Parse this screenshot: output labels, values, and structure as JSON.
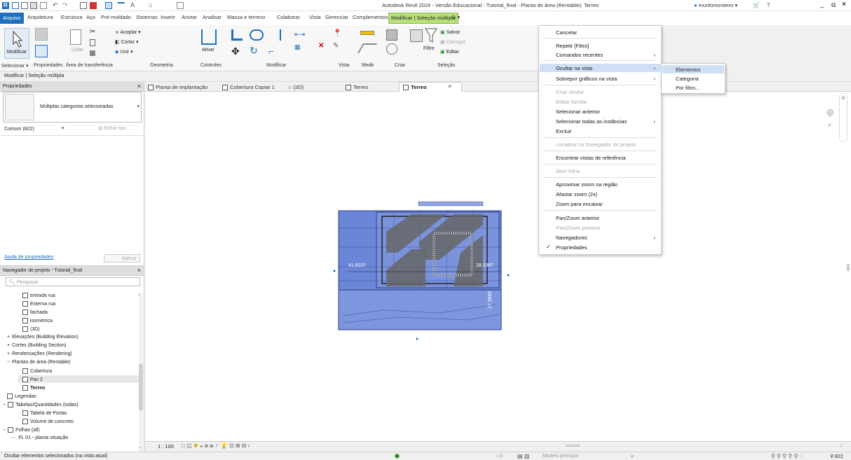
{
  "app": {
    "title": "Autodesk Revit 2024 - Versão Educacional - Tutorial_final - Planta de área (Rentable): Terreo",
    "user": "murilomonteiro"
  },
  "menubar": {
    "tabs": [
      "Arquivo",
      "Arquitetura",
      "Estrutura",
      "Aço",
      "Pré-moldado",
      "Sistemas",
      "Inserir",
      "Anotar",
      "Analisar",
      "Massa e terreno",
      "Colaborar",
      "Vista",
      "Gerenciar",
      "Complementos",
      "Modificar | Seleção múltipla"
    ]
  },
  "ribbon": {
    "modificar": "Modificar",
    "colar": "Colar",
    "acoplar": "Acoplar",
    "cortar": "Cortar",
    "unir": "Unir",
    "ativar": "Ativar",
    "salvar": "Salvar",
    "carregar": "Carregar",
    "editar": "Editar",
    "filtro": "Filtro",
    "panels": [
      "Selecionar ▾",
      "Propriedades",
      "Área de transferência",
      "Geometria",
      "Controles",
      "Modificar",
      "Vista",
      "Medir",
      "Criar",
      "Seleção"
    ]
  },
  "context_bar": "Modificar | Seleção múltipla",
  "properties": {
    "title": "Propriedades",
    "type_label": "Múltiplas categorias selecionadas",
    "filter": "Comum (822)",
    "edit_type": "Editar tipo",
    "help_link": "Ajuda de propriedades",
    "apply": "Aplicar"
  },
  "browser": {
    "title": "Navegador de projeto - Tutorial_final",
    "search_placeholder": "Pesquisar",
    "items": [
      "entrada rua",
      "Externa rua",
      "fachada",
      "isometrica",
      "(3D)",
      "Elevações (Building Elevation)",
      "Cortes (Building Section)",
      "Renderizações (Rendering)",
      "Plantas de área (Rentable)",
      "Cobertura",
      "Pav 2",
      "Terreo",
      "Legendas",
      "Tabelas/Quantidades (todas)",
      "Tabela de Portas",
      "Volume de concreto",
      "Folhas (all)",
      "FL 01 - planta situação"
    ]
  },
  "doc_tabs": [
    "Planta de implantação",
    "Cobertura Copiar 1",
    "{3D}",
    "Terreo",
    "Terreo"
  ],
  "canvas": {
    "dim1": "41.6037",
    "dim2": "28.1967",
    "dim3": "17.3685"
  },
  "view_bar": {
    "scale": "1 : 100"
  },
  "context_menu": {
    "cancelar": "Cancelar",
    "repetir": "Repetir [Filtro]",
    "recentes": "Comandos recentes",
    "ocultar": "Ocultar na vista",
    "sobrepor": "Sobrepor gráficos na vista",
    "criar_similar": "Criar similar",
    "editar_familia": "Editar família",
    "sel_anterior": "Selecionar anterior",
    "sel_todas": "Selecionar todas as instâncias",
    "excluir": "Excluir",
    "localizar": "Localizar no Navegador de projeto",
    "encontrar": "Encontrar vistas de referência",
    "abrir_folha": "Abrir folha",
    "aprox": "Aproximar zoom na região",
    "afastar": "Afastar zoom (2x)",
    "zoom_enc": "Zoom para encaixar",
    "pan_ant": "Pan/Zoom anterior",
    "pan_prox": "Pan/Zoom próximo",
    "navegadores": "Navegadores",
    "propriedades": "Propriedades"
  },
  "submenu": [
    "Elementos",
    "Categoria",
    "Por filtro..."
  ],
  "status": {
    "left": "Ocultar elementos selecionados (na vista atual)",
    "zero": ":0",
    "model": "Modelo principal",
    "count": ":822"
  },
  "colors": {
    "accent": "#1e6fbf",
    "selection_blue": "#6b86d9",
    "highlight": "#cfe0f5",
    "modify_tab": "#b8e07a"
  }
}
